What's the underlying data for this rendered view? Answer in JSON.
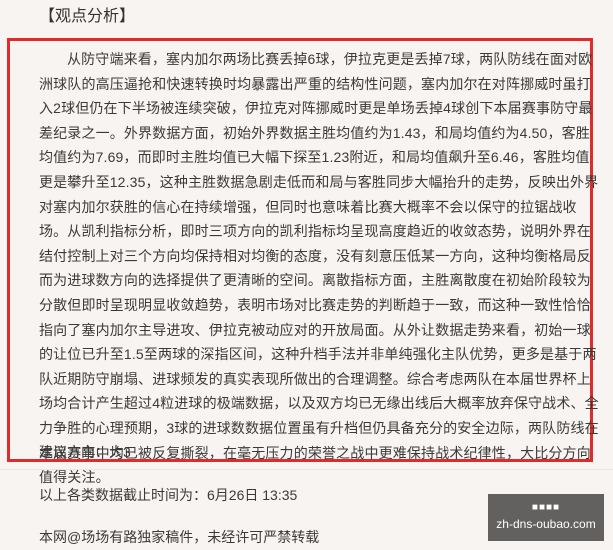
{
  "article": {
    "section_title": "【观点分析】",
    "analysis_paragraph": "从防守端来看，塞内加尔两场比赛丢掉6球，伊拉克更是丢掉7球，两队防线在面对欧洲球队的高压逼抢和快速转换时均暴露出严重的结构性问题，塞内加尔在对阵挪威时虽打入2球但仍在下半场被连续突破，伊拉克对阵挪威时更是单场丢掉4球创下本届赛事防守最差纪录之一。外界数据方面，初始外界数据主胜均值约为1.43，和局均值约为4.50，客胜均值约为7.69，而即时主胜均值已大幅下探至1.23附近，和局均值飙升至6.46，客胜均值更是攀升至12.35，这种主胜数据急剧走低而和局与客胜同步大幅抬升的走势，反映出外界对塞内加尔获胜的信心在持续增强，但同时也意味着比赛大概率不会以保守的拉锯战收场。从凯利指标分析，即时三项方向的凯利指标均呈现高度趋近的收敛态势，说明外界在结付控制上对三个方向均保持相对均衡的态度，没有刻意压低某一方向，这种均衡格局反而为进球数方向的选择提供了更清晰的空间。离散指标方面，主胜离散度在初始阶段较为分散但即时呈现明显收敛趋势，表明市场对比赛走势的判断趋于一致，而这种一致性恰恰指向了塞内加尔主导进攻、伊拉克被动应对的开放局面。从外让数据走势来看，初始一球的让位已升至1.5至两球的深指区间，这种升档手法并非单纯强化主队优势，更多是基于两队近期防守崩塌、进球频发的真实表现所做出的合理调整。综合考虑两队在本届世界杯上场均合计产生超过4粒进球的极端数据，以及双方均已无缘出线后大概率放弃保守战术、全力争胜的心理预期，3球的进球数数据位置虽有升档但仍具备充分的安全边际，两队防线在本届赛事中均已被反复撕裂，在毫无压力的荣誉之战中更难保持战术纪律性，大比分方向值得关注。",
    "advice": "建议方向：大3",
    "timestamp": "以上各类数据截止时间为：6月26日 13:35",
    "copyright": "本网@场场有路独家稿件，未经许可严禁转载"
  },
  "watermark": {
    "top_text": "■■■■",
    "bottom_text": "zh-dns-oubao.com"
  },
  "colors": {
    "highlight_border": "#e02b2b",
    "background": "#f7f4f1",
    "text": "#3a3a3a"
  }
}
